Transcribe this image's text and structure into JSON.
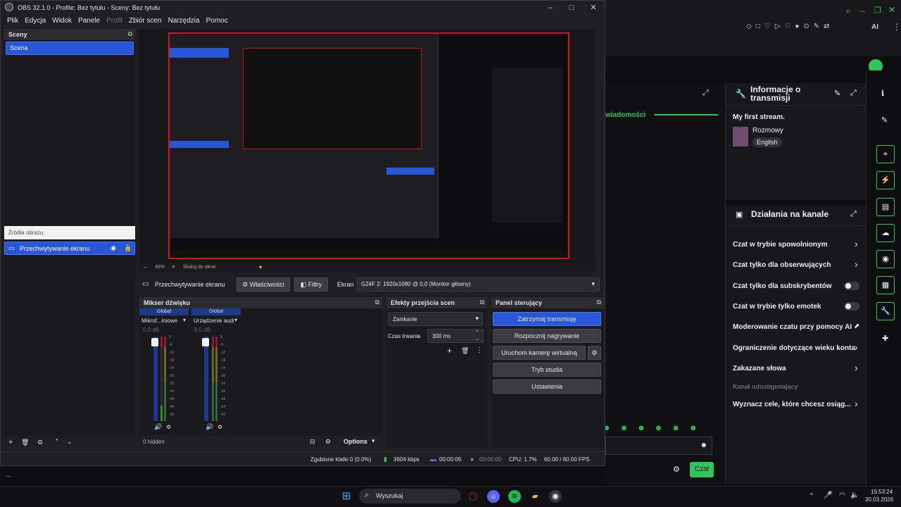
{
  "obs": {
    "title": "OBS 32.1.0 - Profile: Bez tytułu - Sceny: Bez tytułu",
    "menu": [
      "Plik",
      "Edycja",
      "Widok",
      "Panele",
      "Profil",
      "Zbiór scen",
      "Narzędzia",
      "Pomoc"
    ],
    "scenes": {
      "header": "Sceny",
      "items": [
        "Scena"
      ]
    },
    "sources": {
      "header": "Źródła obrazu",
      "items": [
        "Przechwytywanie ekranu"
      ]
    },
    "zoom": {
      "value": "46%",
      "fit_label": "Skaluj do okna"
    },
    "source_toolbar": {
      "source": "Przechwytywanie ekranu",
      "properties": "Właściwości",
      "filters": "Filtry",
      "screen_label": "Ekran",
      "screen_value": "G24F 2: 1920x1080 @ 0,0 (Monitor główny)"
    },
    "mixer": {
      "header": "Mikser dźwięku",
      "channels": [
        {
          "group": "Global",
          "name": "Mikrof...iniowe",
          "db": "0.0 dB"
        },
        {
          "group": "Global",
          "name": "Urządzenie audio",
          "db": "0.0 dB"
        }
      ],
      "ticks": [
        "0",
        "-6",
        "-12",
        "-18",
        "-24",
        "-30",
        "-36",
        "-42",
        "-48",
        "-54",
        "-60"
      ],
      "hidden": "0 hidden",
      "options": "Options"
    },
    "transitions": {
      "header": "Efekty przejścia scen",
      "type": "Zanikanie",
      "duration_label": "Czas trwania",
      "duration": "300 ms"
    },
    "controls": {
      "header": "Panel sterujący",
      "stop_stream": "Zatrzymaj transmisję",
      "record": "Rozpocznij nagrywanie",
      "virtualcam": "Uruchom kamerę wirtualną",
      "studio": "Tryb studia",
      "settings": "Ustawienia"
    },
    "status": {
      "dropped": "Zgubione klatki 0 (0.0%)",
      "bitrate": "3604 kbps",
      "stream_time": "00:00:09",
      "rec_time": "00:00:00",
      "cpu": "CPU: 1.7%",
      "fps": "60.00 / 60.00 FPS"
    }
  },
  "twitch": {
    "stream_info": {
      "title": "Informacje o transmisji",
      "stream_title": "My first stream.",
      "category": "Rozmowy",
      "tag": "English"
    },
    "messages_label": "wiadomości",
    "channel_actions": {
      "title": "Działania na kanale",
      "items": [
        {
          "label": "Czat w trybie spowolnionym",
          "control": "chevron"
        },
        {
          "label": "Czat tylko dla obserwujących",
          "control": "chevron"
        },
        {
          "label": "Czat tylko dla subskrybentów",
          "control": "toggle"
        },
        {
          "label": "Czat w trybie tylko emotek",
          "control": "toggle"
        },
        {
          "label": "Moderowanie czatu przy pomocy AI",
          "control": "external"
        },
        {
          "label": "Ograniczenie dotyczące wieku konta",
          "control": "chevron"
        },
        {
          "label": "Zakazane słowa",
          "control": "chevron"
        }
      ],
      "section_label": "Kanał udostępniający",
      "goals": "Wyznacz cele, które chcesz osiąg..."
    },
    "chat_button": "Czat",
    "topbar_text": "AI"
  },
  "taskbar": {
    "search": "Wyszukaj",
    "time": "15:53:24",
    "date": "30.03.2026"
  },
  "colors": {
    "accent_obs": "#2856d8",
    "accent_twitch": "#2fc55a",
    "record_border": "#d0141e"
  }
}
